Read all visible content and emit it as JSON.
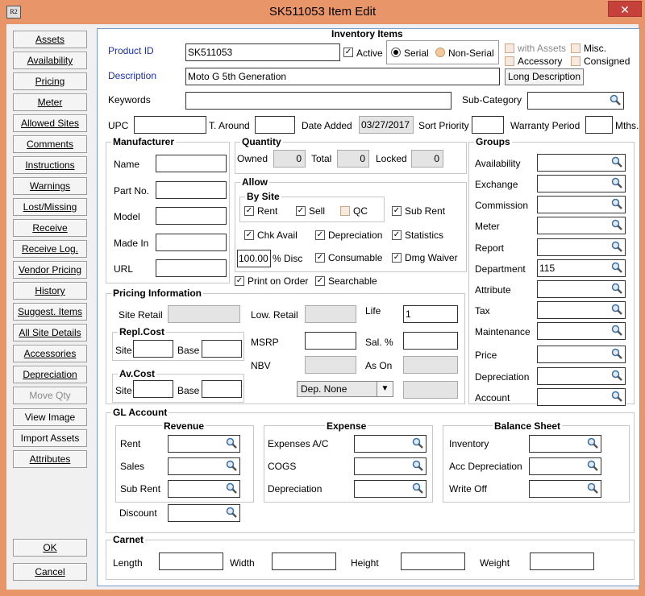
{
  "window": {
    "title": "SK511053 Item Edit",
    "close": "✕",
    "app_icon": "R2"
  },
  "side_buttons": [
    "Assets",
    "Availability",
    "Pricing",
    "Meter",
    "Allowed Sites",
    "Comments",
    "Instructions",
    "Warnings",
    "Lost/Missing",
    "Receive",
    "Receive Log.",
    "Vendor Pricing",
    "History",
    "Suggest. Items",
    "All Site Details",
    "Accessories",
    "Depreciation",
    "Move Qty",
    "View Image",
    "Import Assets",
    "Attributes"
  ],
  "ok": "OK",
  "cancel": "Cancel",
  "inv": {
    "title": "Inventory Items",
    "product_id_label": "Product ID",
    "product_id": "SK511053",
    "active": "Active",
    "serial": "Serial",
    "nonserial": "Non-Serial",
    "with_assets": "with Assets",
    "misc": "Misc.",
    "accessory": "Accessory",
    "consigned": "Consigned",
    "description_label": "Description",
    "description": "Moto G 5th Generation",
    "long_desc": "Long Description",
    "keywords": "Keywords",
    "subcat": "Sub-Category",
    "upc": "UPC",
    "taround": "T. Around",
    "date_added_label": "Date Added",
    "date_added": "03/27/2017",
    "sort_priority": "Sort Priority",
    "warranty": "Warranty Period",
    "mths": "Mths."
  },
  "manufacturer": {
    "title": "Manufacturer",
    "name": "Name",
    "part": "Part No.",
    "model": "Model",
    "made_in": "Made In",
    "url": "URL"
  },
  "quantity": {
    "title": "Quantity",
    "owned": "Owned",
    "owned_v": "0",
    "total": "Total",
    "total_v": "0",
    "locked": "Locked",
    "locked_v": "0"
  },
  "allow": {
    "title": "Allow",
    "bysite": "By Site",
    "rent": "Rent",
    "sell": "Sell",
    "qc": "QC",
    "subrent": "Sub Rent",
    "chkavail": "Chk Avail",
    "depreciation": "Depreciation",
    "statistics": "Statistics",
    "disc_v": "100.00",
    "disc": "% Disc",
    "consumable": "Consumable",
    "dmgwaiver": "Dmg Waiver",
    "print": "Print on Order",
    "searchable": "Searchable"
  },
  "pricing": {
    "title": "Pricing Information",
    "site_retail": "Site Retail",
    "low_retail": "Low. Retail",
    "life": "Life",
    "life_v": "1",
    "replcost": "Repl.Cost",
    "site": "Site",
    "base": "Base",
    "msrp": "MSRP",
    "sal": "Sal. %",
    "nbv": "NBV",
    "ason": "As On",
    "avcost": "Av.Cost",
    "dep": "Dep. None"
  },
  "groups": {
    "title": "Groups",
    "items": [
      "Availability",
      "Exchange",
      "Commission",
      "Meter",
      "Report",
      "Department",
      "Attribute",
      "Tax",
      "Maintenance",
      "Price",
      "Depreciation",
      "Account"
    ],
    "department_value": "115"
  },
  "gl": {
    "title": "GL Account",
    "revenue": "Revenue",
    "rev_items": [
      "Rent",
      "Sales",
      "Sub Rent"
    ],
    "discount": "Discount",
    "expense": "Expense",
    "exp_items": [
      "Expenses A/C",
      "COGS",
      "Depreciation"
    ],
    "balance": "Balance Sheet",
    "bal_items": [
      "Inventory",
      "Acc Depreciation",
      "Write Off"
    ]
  },
  "carnet": {
    "title": "Carnet",
    "length": "Length",
    "width": "Width",
    "height": "Height",
    "weight": "Weight"
  }
}
